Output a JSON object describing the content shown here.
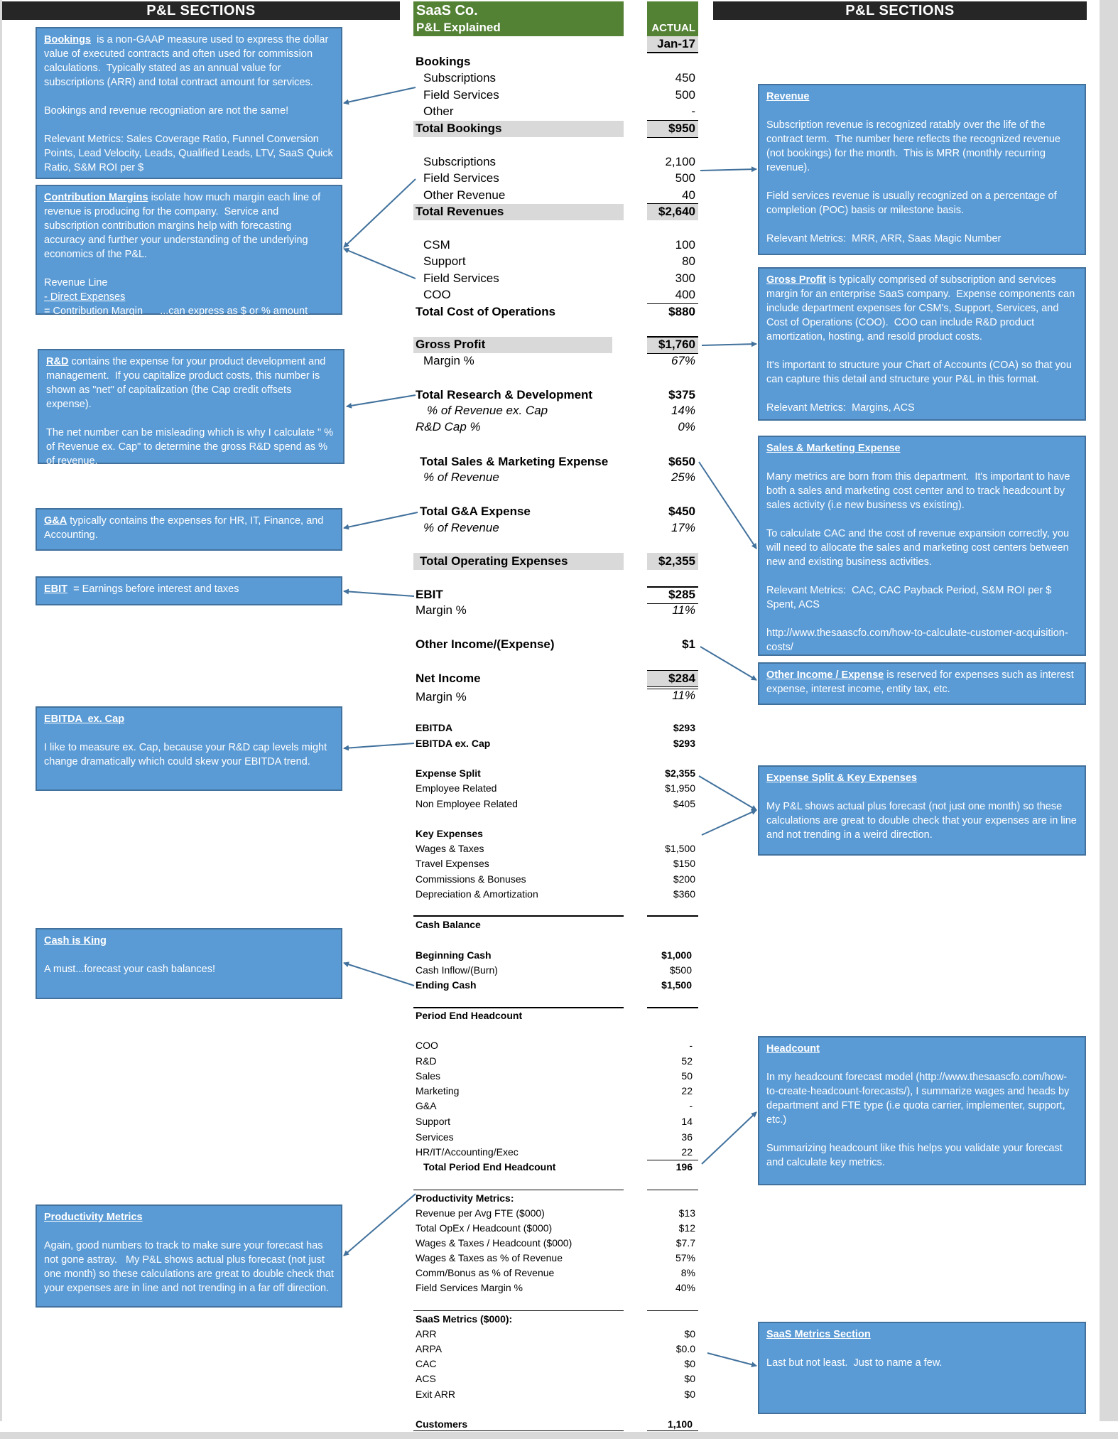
{
  "headers": {
    "left": "P&L SECTIONS",
    "right": "P&L SECTIONS"
  },
  "title": {
    "company": "SaaS Co.",
    "subtitle": "P&L Explained",
    "column_label": "ACTUAL",
    "period": "Jan-17"
  },
  "pnl": {
    "bookings": {
      "heading": "Bookings",
      "rows": [
        {
          "label": "Subscriptions",
          "value": "450"
        },
        {
          "label": "Field Services",
          "value": "500"
        },
        {
          "label": "Other",
          "value": "-"
        }
      ],
      "total": {
        "label": "Total Bookings",
        "value": "$950"
      }
    },
    "revenue": {
      "rows": [
        {
          "label": "Subscriptions",
          "value": "2,100"
        },
        {
          "label": "Field Services",
          "value": "500"
        },
        {
          "label": "Other Revenue",
          "value": "40"
        }
      ],
      "total": {
        "label": "Total Revenues",
        "value": "$2,640"
      }
    },
    "cost_of_operations": {
      "rows": [
        {
          "label": "CSM",
          "value": "100"
        },
        {
          "label": "Support",
          "value": "80"
        },
        {
          "label": "Field Services",
          "value": "300"
        },
        {
          "label": "COO",
          "value": "400"
        }
      ],
      "total": {
        "label": "Total Cost of Operations",
        "value": "$880"
      }
    },
    "gross_profit": {
      "label": "Gross Profit",
      "value": "$1,760",
      "margin_label": "Margin %",
      "margin_value": "67%"
    },
    "rnd": {
      "label": "Total Research & Development",
      "value": "$375",
      "pct_label": "% of Revenue ex. Cap",
      "pct_value": "14%",
      "cap_label": "R&D Cap %",
      "cap_value": "0%"
    },
    "sm": {
      "label": "Total Sales & Marketing Expense",
      "value": "$650",
      "pct_label": "% of Revenue",
      "pct_value": "25%"
    },
    "ga": {
      "label": "Total G&A Expense",
      "value": "$450",
      "pct_label": "% of Revenue",
      "pct_value": "17%"
    },
    "opex": {
      "label": "Total Operating Expenses",
      "value": "$2,355"
    },
    "ebit": {
      "label": "EBIT",
      "value": "$285",
      "margin_label": "Margin %",
      "margin_value": "11%"
    },
    "other_income": {
      "label": "Other Income/(Expense)",
      "value": "$1"
    },
    "net_income": {
      "label": "Net Income",
      "value": "$284",
      "margin_label": "Margin %",
      "margin_value": "11%"
    },
    "ebitda": {
      "label": "EBITDA",
      "value": "$293",
      "excap_label": "EBITDA ex. Cap",
      "excap_value": "$293"
    },
    "expense_split": {
      "heading": "Expense Split",
      "heading_value": "$2,355",
      "rows": [
        {
          "label": "Employee Related",
          "value": "$1,950"
        },
        {
          "label": "Non Employee Related",
          "value": "$405"
        }
      ]
    },
    "key_expenses": {
      "heading": "Key Expenses",
      "rows": [
        {
          "label": "Wages & Taxes",
          "value": "$1,500"
        },
        {
          "label": "Travel Expenses",
          "value": "$150"
        },
        {
          "label": "Commissions & Bonuses",
          "value": "$200"
        },
        {
          "label": "Depreciation & Amortization",
          "value": "$360"
        }
      ]
    },
    "cash": {
      "heading": "Cash Balance",
      "beginning": {
        "label": "Beginning Cash",
        "value": "$1,000"
      },
      "inflow": {
        "label": "Cash Inflow/(Burn)",
        "value": "$500"
      },
      "ending": {
        "label": "Ending Cash",
        "value": "$1,500"
      }
    },
    "headcount": {
      "heading": "Period End Headcount",
      "rows": [
        {
          "label": "COO",
          "value": "-"
        },
        {
          "label": "R&D",
          "value": "52"
        },
        {
          "label": "Sales",
          "value": "50"
        },
        {
          "label": "Marketing",
          "value": "22"
        },
        {
          "label": "G&A",
          "value": "-"
        },
        {
          "label": "Support",
          "value": "14"
        },
        {
          "label": "Services",
          "value": "36"
        },
        {
          "label": "HR/IT/Accounting/Exec",
          "value": "22"
        }
      ],
      "total": {
        "label": "Total Period End Headcount",
        "value": "196"
      }
    },
    "productivity": {
      "heading": "Productivity Metrics:",
      "rows": [
        {
          "label": "Revenue per Avg FTE ($000)",
          "value": "$13"
        },
        {
          "label": "Total OpEx / Headcount ($000)",
          "value": "$12"
        },
        {
          "label": "Wages & Taxes / Headcount ($000)",
          "value": "$7.7"
        },
        {
          "label": "Wages & Taxes as % of Revenue",
          "value": "57%"
        },
        {
          "label": "Comm/Bonus as % of Revenue",
          "value": "8%"
        },
        {
          "label": "Field Services Margin %",
          "value": "40%"
        }
      ]
    },
    "saas_metrics": {
      "heading": "SaaS Metrics ($000):",
      "rows": [
        {
          "label": "ARR",
          "value": "$0"
        },
        {
          "label": "ARPA",
          "value": "$0.0"
        },
        {
          "label": "CAC",
          "value": "$0"
        },
        {
          "label": "ACS",
          "value": "$0"
        },
        {
          "label": "Exit ARR",
          "value": "$0"
        }
      ]
    },
    "customers": {
      "label": "Customers",
      "value": "1,100"
    }
  },
  "notes": {
    "bookings": {
      "title": "Bookings",
      "body": "  is a non-GAAP measure used to express the dollar value of executed contracts and often used for commission calculations.  Typically stated as an annual value for subscriptions (ARR) and total contract amount for services.\n\nBookings and revenue recogniation are not the same!\n\nRelevant Metrics: Sales Coverage Ratio, Funnel Conversion Points, Lead Velocity, Leads, Qualified Leads, LTV, SaaS Quick Ratio, S&M ROI per $"
    },
    "contribution": {
      "title": "Contribution Margins",
      "body": " isolate how much margin each line of revenue is producing for the company.  Service and subscription contribution margins help with forecasting accuracy and further your understanding of the underlying economics of the P&L.\n\nRevenue Line",
      "line2": "- Direct Expenses",
      "line3": "= Contribution Margin      ...can express as $ or % amount"
    },
    "rnd": {
      "title": "R&D",
      "body": " contains the expense for your product development and management.  If you capitalize product costs, this number is shown as \"net\" of capitalization (the Cap credit offsets expense).\n\nThe net number can be misleading which is why I calculate \" % of Revenue ex. Cap\" to determine the gross R&D spend as % of revenue."
    },
    "ga": {
      "title": "G&A",
      "body": " typically contains the expenses for HR, IT, Finance, and Accounting."
    },
    "ebit": {
      "title": "EBIT",
      "body": "  = Earnings before interest and taxes"
    },
    "ebitda": {
      "title": "EBITDA  ex. Cap",
      "body": "\n\nI like to measure ex. Cap, because your R&D cap levels might change dramatically which could skew your EBITDA trend."
    },
    "cash": {
      "title": "Cash is King",
      "body": "\n\nA must...forecast your cash balances!"
    },
    "productivity": {
      "title": "Productivity Metrics",
      "body": "\n\nAgain, good numbers to track to make sure your forecast has not gone astray.   My P&L shows actual plus forecast (not just one month) so these calculations are great to double check that your expenses are in line and not trending in a far off direction."
    },
    "revenue": {
      "title": "Revenue",
      "body": "\n\nSubscription revenue is recognized ratably over the life of the contract term.  The number here reflects the recognized revenue (not bookings) for the month.  This is MRR (monthly recurring revenue).\n\nField services revenue is usually recognized on a percentage of completion (POC) basis or milestone basis.\n\nRelevant Metrics:  MRR, ARR, Saas Magic Number"
    },
    "gross_profit": {
      "title": "Gross Profit",
      "body": " is typically comprised of subscription and services margin for an enterprise SaaS company.  Expense components can include department expenses for CSM's, Support, Services, and Cost of Operations (COO).  COO can include R&D product amortization, hosting, and resold product costs.\n\nIt's important to structure your Chart of Accounts (COA) so that you can capture this detail and structure your P&L in this format.\n\nRelevant Metrics:  Margins, ACS"
    },
    "sm": {
      "title": "Sales & Marketing Expense",
      "body": "\n\nMany metrics are born from this department.  It's important to have both a sales and marketing cost center and to track headcount by sales activity (i.e new business vs existing).\n\nTo calculate CAC and the cost of revenue expansion correctly, you will need to allocate the sales and marketing cost centers between new and existing business activities.\n\nRelevant Metrics:  CAC, CAC Payback Period, S&M ROI per $ Spent, ACS\n\nhttp://www.thesaascfo.com/how-to-calculate-customer-acquisition-costs/"
    },
    "other_income": {
      "title": "Other Income / Expense",
      "body": " is reserved for expenses such as interest expense, interest income, entity tax, etc."
    },
    "expense_split": {
      "title": "Expense Split & Key Expenses",
      "body": "\n\nMy P&L shows actual plus forecast (not just one month) so these calculations are great to double check that your expenses are in line and not trending in a weird direction."
    },
    "headcount": {
      "title": "Headcount",
      "body": "\n\nIn my headcount forecast model (http://www.thesaascfo.com/how-to-create-headcount-forecasts/), I summarize wages and heads by department and FTE type (i.e quota carrier, implementer, support, etc.)\n\nSummarizing headcount like this helps you validate your forecast and calculate key metrics."
    },
    "saas_metrics": {
      "title": "SaaS Metrics Section",
      "body": "\n\nLast but not least.  Just to name a few."
    }
  },
  "colors": {
    "header_bg": "#262626",
    "title_green": "#548235",
    "note_blue": "#5b9bd5",
    "note_border": "#41719c",
    "band_gray": "#d9d9d9",
    "arrow": "#41719c"
  }
}
